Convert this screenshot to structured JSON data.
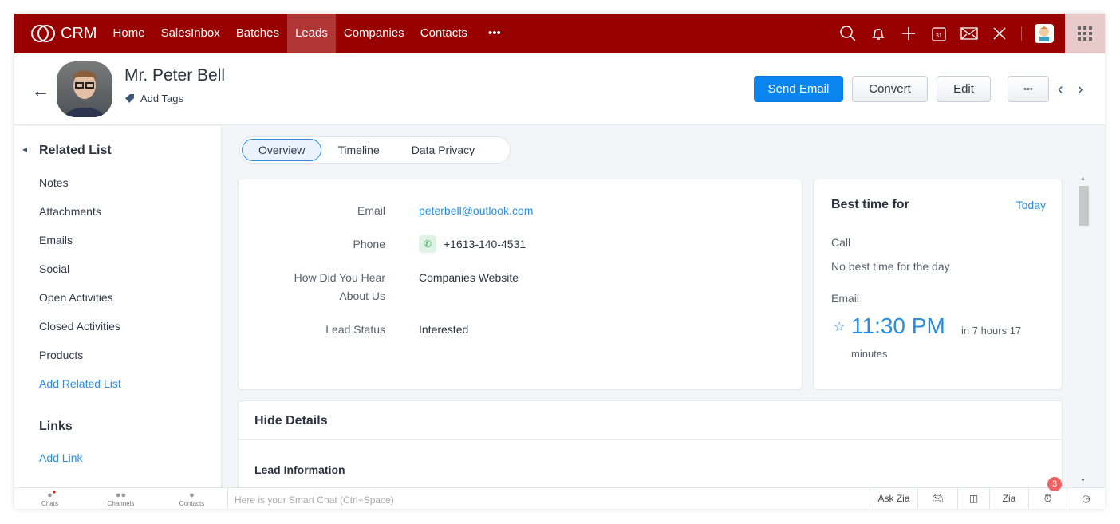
{
  "nav": {
    "brand": "CRM",
    "items": [
      {
        "label": "Home"
      },
      {
        "label": "SalesInbox"
      },
      {
        "label": "Batches"
      },
      {
        "label": "Leads",
        "active": true
      },
      {
        "label": "Companies"
      },
      {
        "label": "Contacts"
      },
      {
        "label": "•••"
      }
    ],
    "icons": [
      "search-icon",
      "bell-icon",
      "plus-icon",
      "calendar-icon",
      "mail-icon",
      "tools-icon",
      "user-avatar",
      "apps-grid-icon"
    ],
    "color": "#990000",
    "calendar_day": "31"
  },
  "record": {
    "name": "Mr. Peter Bell",
    "add_tags": "Add Tags"
  },
  "actions": {
    "send_email": "Send Email",
    "convert": "Convert",
    "edit": "Edit",
    "more": "•••"
  },
  "sidebar": {
    "title": "Related List",
    "items": [
      "Notes",
      "Attachments",
      "Emails",
      "Social",
      "Open Activities",
      "Closed Activities",
      "Products"
    ],
    "add_related": "Add Related List",
    "links_title": "Links",
    "add_link": "Add Link"
  },
  "tabs": [
    "Overview",
    "Timeline",
    "Data Privacy"
  ],
  "overview": {
    "email_label": "Email",
    "email": "peterbell@outlook.com",
    "phone_label": "Phone",
    "phone": "+1613-140-4531",
    "hear_label_1": "How Did You Hear",
    "hear_label_2": "About Us",
    "hear": "Companies Website",
    "status_label": "Lead Status",
    "status": "Interested"
  },
  "best_time": {
    "title": "Best time for",
    "today": "Today",
    "call": "Call",
    "call_value": "No best time for the day",
    "email": "Email",
    "time": "11:30 PM",
    "in": "in 7 hours 17",
    "in2": "minutes"
  },
  "details": {
    "hide": "Hide Details",
    "section": "Lead Information"
  },
  "bottom": {
    "chats": "Chats",
    "channels": "Channels",
    "contacts": "Contacts",
    "placeholder": "Here is your Smart Chat (Ctrl+Space)",
    "ask_zia": "Ask Zia",
    "badge": "3"
  }
}
